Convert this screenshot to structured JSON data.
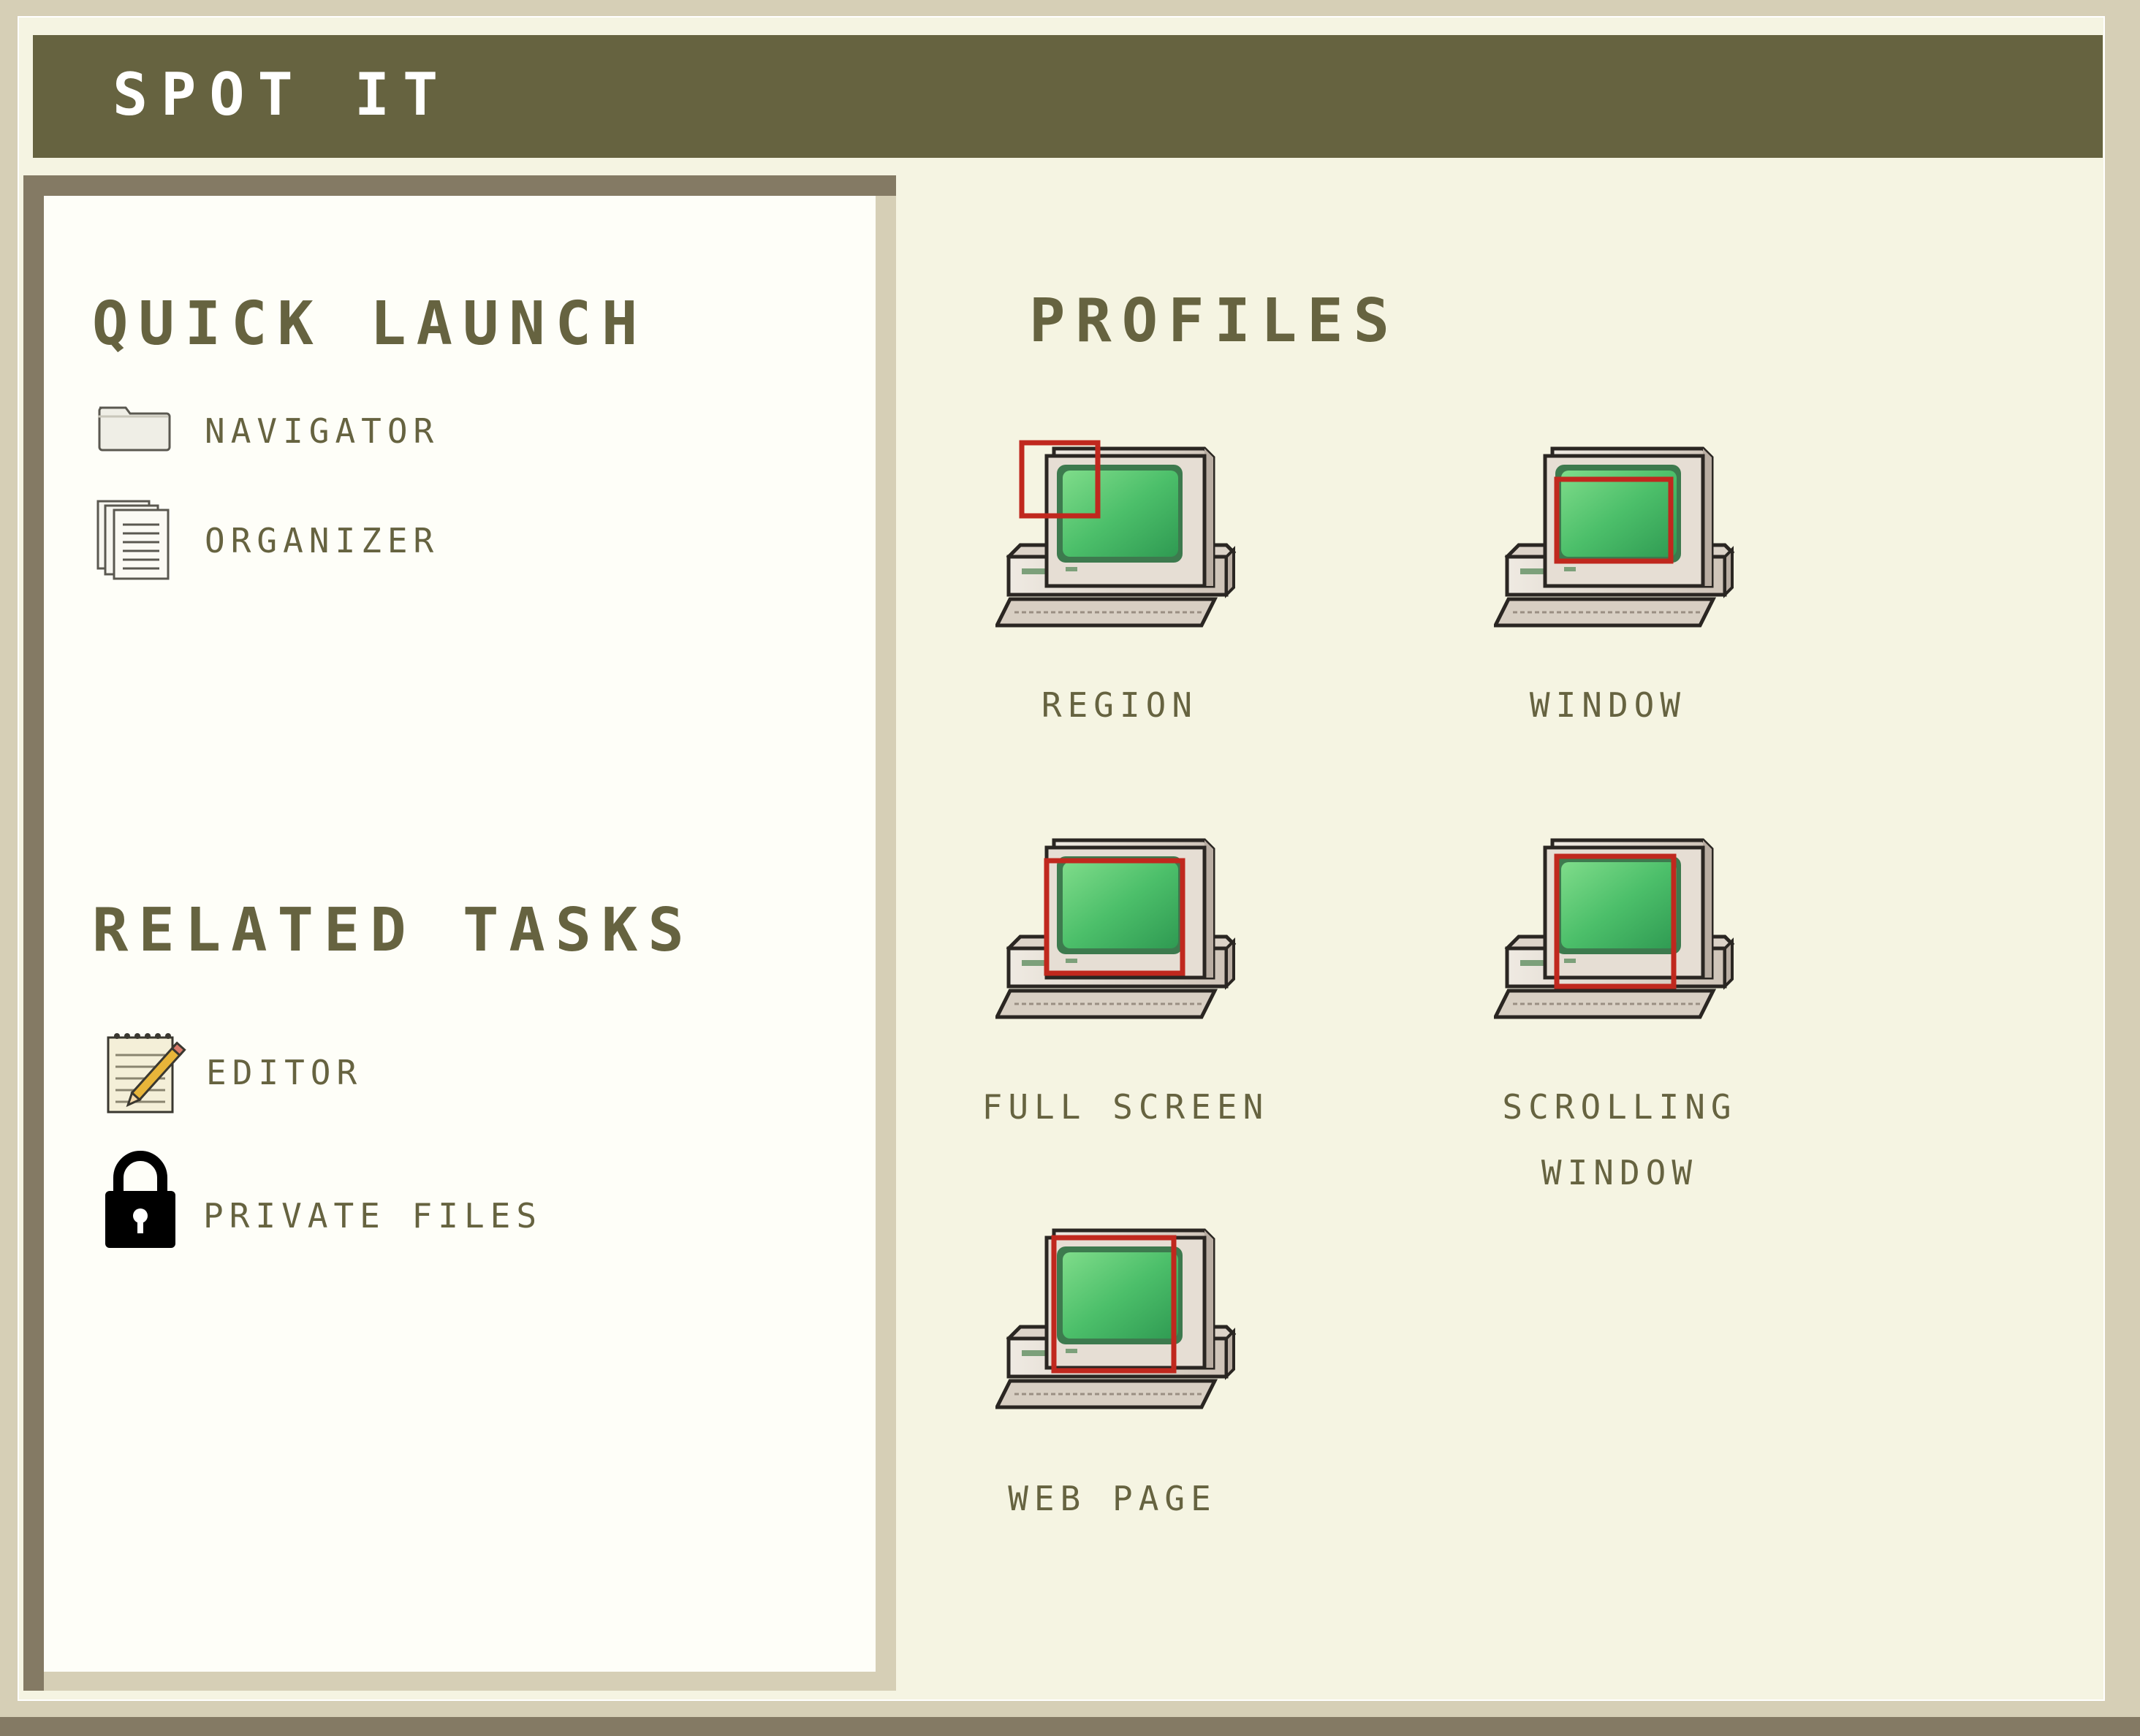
{
  "app": {
    "title": "SPOT IT"
  },
  "sidebar": {
    "quick_launch": {
      "title": "QUICK LAUNCH",
      "items": [
        {
          "label": "NAVIGATOR",
          "icon": "folder-icon"
        },
        {
          "label": "ORGANIZER",
          "icon": "documents-icon"
        }
      ]
    },
    "related_tasks": {
      "title": "RELATED TASKS",
      "items": [
        {
          "label": "EDITOR",
          "icon": "notepad-pencil-icon"
        },
        {
          "label": "PRIVATE FILES",
          "icon": "lock-icon"
        }
      ]
    }
  },
  "main": {
    "title": "PROFILES",
    "profiles": [
      {
        "label": "REGION",
        "icon": "computer-region-icon"
      },
      {
        "label": "WINDOW",
        "icon": "computer-window-icon"
      },
      {
        "label": "FULL SCREEN",
        "icon": "computer-full-screen-icon"
      },
      {
        "label": "SCROLLING\nWINDOW",
        "icon": "computer-scrolling-window-icon"
      },
      {
        "label": "WEB PAGE",
        "icon": "computer-web-page-icon"
      }
    ]
  },
  "colors": {
    "olive": "#666340",
    "frame": "#d6cfb6",
    "dark_frame": "#847a64",
    "panel_bg": "#f5f4e2",
    "sidebar_bg": "#fefef8",
    "screen_green": "#4cbf6a",
    "selection_red": "#c0281e"
  }
}
